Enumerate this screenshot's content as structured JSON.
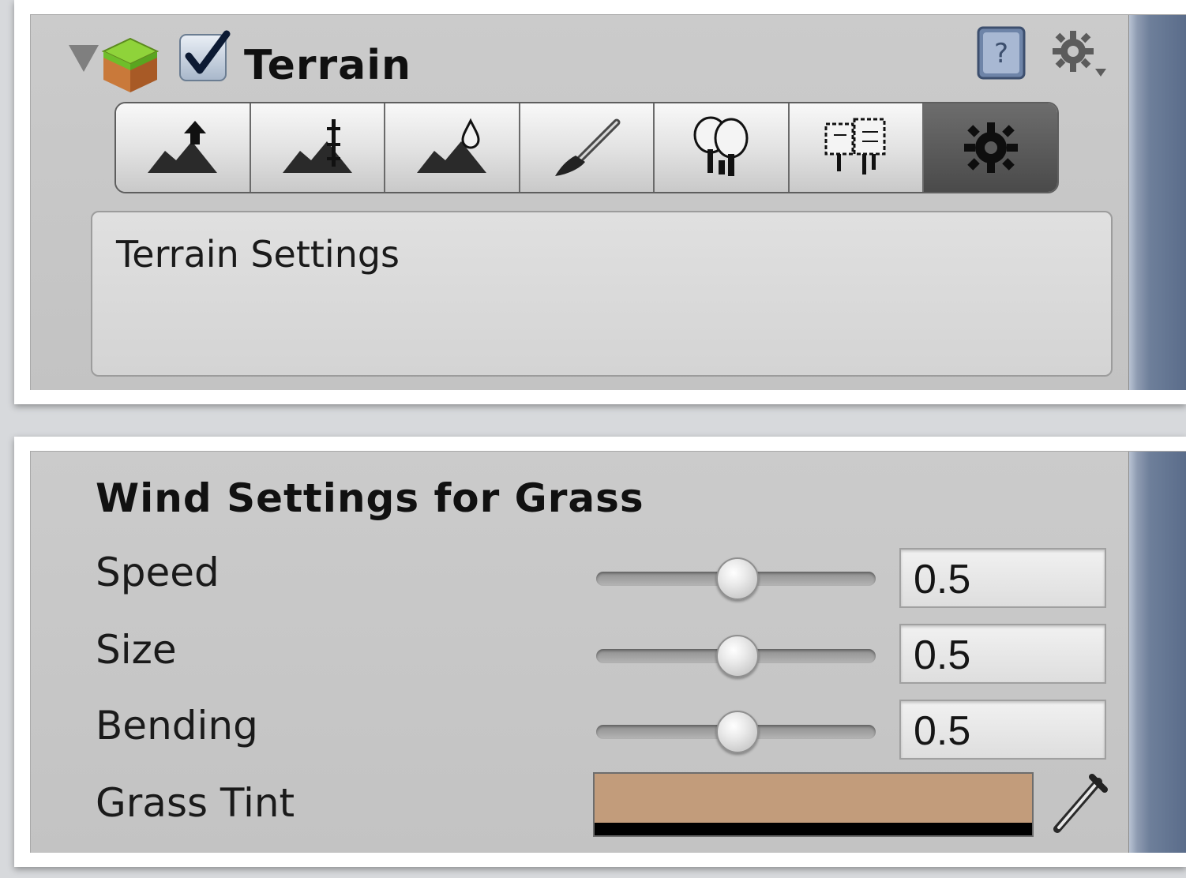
{
  "header": {
    "title": "Terrain",
    "enabled": true
  },
  "toolbar": {
    "tools": [
      {
        "icon": "raise-lower-terrain-icon",
        "active": false
      },
      {
        "icon": "paint-height-icon",
        "active": false
      },
      {
        "icon": "smooth-height-icon",
        "active": false
      },
      {
        "icon": "paint-texture-icon",
        "active": false
      },
      {
        "icon": "place-trees-icon",
        "active": false
      },
      {
        "icon": "paint-details-icon",
        "active": false
      },
      {
        "icon": "terrain-settings-icon",
        "active": true
      }
    ]
  },
  "settings_box": {
    "label": "Terrain Settings"
  },
  "wind": {
    "title": "Wind Settings for Grass",
    "speed": {
      "label": "Speed",
      "value": "0.5",
      "fraction": 0.5
    },
    "size": {
      "label": "Size",
      "value": "0.5",
      "fraction": 0.5
    },
    "bending": {
      "label": "Bending",
      "value": "0.5",
      "fraction": 0.5
    },
    "grass_tint": {
      "label": "Grass Tint",
      "color": "#c29c7b"
    }
  },
  "colors": {
    "panel": "#c7c7c7",
    "accent_blue": "#5a6c8a",
    "active_tool": "#555555"
  }
}
